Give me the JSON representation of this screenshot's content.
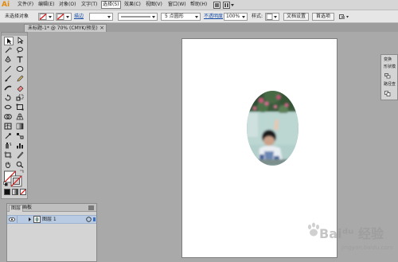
{
  "app": {
    "logo": "Ai"
  },
  "menu": {
    "items": [
      "文件(F)",
      "编辑(E)",
      "对象(O)",
      "文字(T)",
      "选择(S)",
      "效果(C)",
      "视图(V)",
      "窗口(W)",
      "帮助(H)"
    ],
    "active": "选择(S)"
  },
  "control": {
    "selection_status": "未选择对象",
    "stroke_link": "描边",
    "stroke_weight": "",
    "brush": "5 点圆形",
    "opacity_link": "不透明度",
    "opacity_value": "100%",
    "style_label": "样式:",
    "doc_setup_button": "文档设置",
    "preferences_button": "首选项"
  },
  "document": {
    "tab_label": "未标题-1* @ 70% (CMYK/预览)",
    "close_glyph": "×"
  },
  "layers_panel": {
    "tabs": [
      "图层",
      "画板"
    ],
    "active_tab": "图层",
    "layer_name": "图层 1"
  },
  "right_panel": {
    "items": [
      "变换",
      "形状模",
      "路径查"
    ]
  },
  "watermark": {
    "text": "Baiᵈᵘ 经验",
    "subtext": "jingyan.baidu.com"
  },
  "colors": {
    "logo": "#e48a0b",
    "link": "#1a4fa8",
    "selection_row": "#b9cbe3"
  }
}
